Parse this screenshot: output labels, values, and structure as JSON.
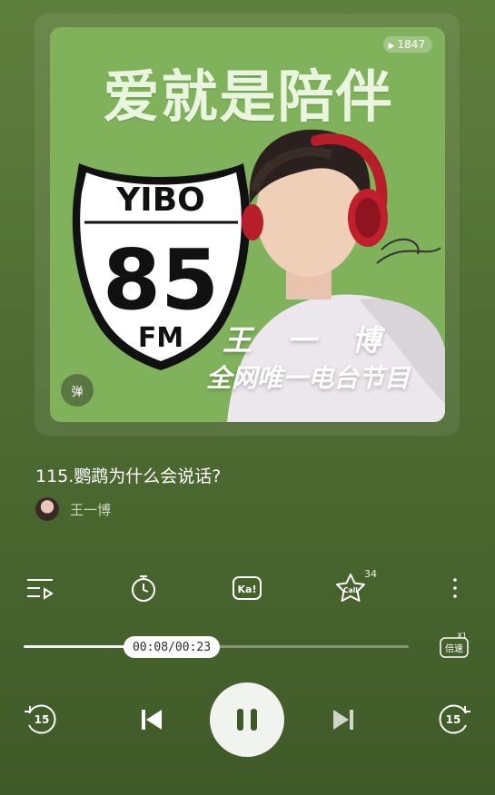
{
  "cover": {
    "play_count": "1847",
    "headline": "爱就是陪伴",
    "shield_top": "YIBO",
    "shield_number": "85",
    "shield_bottom": "FM",
    "host_name": "王 一 博",
    "program_tag": "全网唯一电台节目",
    "danmaku_label": "弹"
  },
  "episode": {
    "title": "115.鹦鹉为什么会说话?",
    "author": "王一博"
  },
  "actions": {
    "ka_label": "Ka!",
    "call_label": "Call",
    "call_count": "34"
  },
  "progress": {
    "current": "00:08",
    "total": "00:23",
    "time_text": "00:08/00:23",
    "fraction": 0.35
  },
  "speed": {
    "multiplier": "X1",
    "label": "倍速"
  },
  "controls": {
    "rewind_label": "15",
    "forward_label": "15"
  },
  "icons": {
    "playlist": "playlist-icon",
    "timer": "timer-icon",
    "ka": "ka-icon",
    "call": "call-star-icon",
    "more": "more-icon",
    "prev": "previous-icon",
    "pause": "pause-icon",
    "next": "next-icon",
    "rewind": "rewind-15-icon",
    "forward": "forward-15-icon"
  },
  "colors": {
    "background": "#4f6d33",
    "cover_bg": "#7fb25a"
  }
}
